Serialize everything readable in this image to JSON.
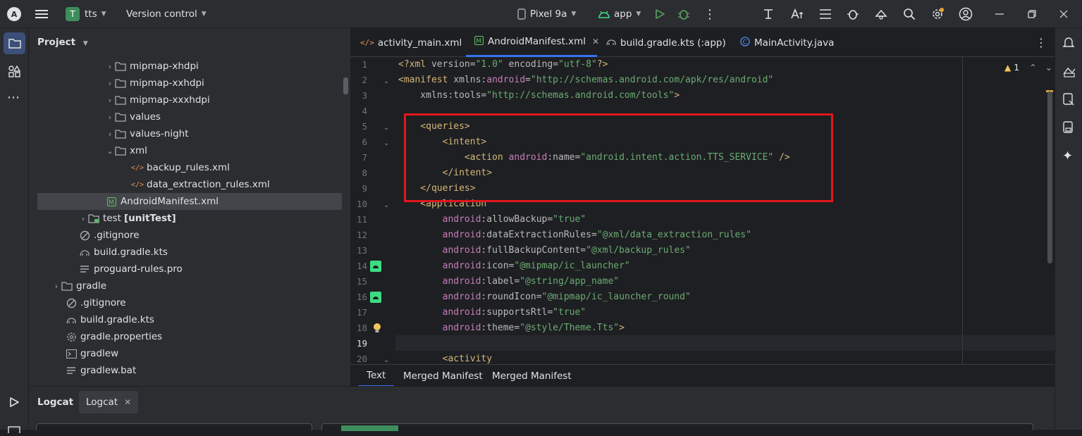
{
  "topbar": {
    "project_letter": "T",
    "project_name": "tts",
    "version_control": "Version control",
    "device": "Pixel 9a",
    "run_config": "app"
  },
  "project_panel": {
    "title": "Project",
    "tree": [
      {
        "label": "mipmap-xhdpi",
        "type": "folder",
        "expander": "›"
      },
      {
        "label": "mipmap-xxhdpi",
        "type": "folder",
        "expander": "›"
      },
      {
        "label": "mipmap-xxxhdpi",
        "type": "folder",
        "expander": "›"
      },
      {
        "label": "values",
        "type": "folder",
        "expander": "›"
      },
      {
        "label": "values-night",
        "type": "folder",
        "expander": "›"
      },
      {
        "label": "xml",
        "type": "folder",
        "expander": "⌄"
      },
      {
        "label": "backup_rules.xml",
        "type": "xml"
      },
      {
        "label": "data_extraction_rules.xml",
        "type": "xml"
      },
      {
        "label": "AndroidManifest.xml",
        "type": "manifest",
        "selected": true
      },
      {
        "label": "test",
        "suffix": "[unitTest]",
        "type": "testfolder",
        "expander": "›"
      },
      {
        "label": ".gitignore",
        "type": "ignore"
      },
      {
        "label": "build.gradle.kts",
        "type": "gradle"
      },
      {
        "label": "proguard-rules.pro",
        "type": "text"
      },
      {
        "label": "gradle",
        "type": "folder",
        "expander": "›"
      },
      {
        "label": ".gitignore",
        "type": "ignore"
      },
      {
        "label": "build.gradle.kts",
        "type": "gradle"
      },
      {
        "label": "gradle.properties",
        "type": "settings"
      },
      {
        "label": "gradlew",
        "type": "terminal"
      },
      {
        "label": "gradlew.bat",
        "type": "text"
      }
    ]
  },
  "editor": {
    "tabs": [
      {
        "label": "activity_main.xml",
        "icon": "xml-icon"
      },
      {
        "label": "AndroidManifest.xml",
        "icon": "manifest-icon",
        "active": true
      },
      {
        "label": "build.gradle.kts (:app)",
        "icon": "gradle-icon"
      },
      {
        "label": "MainActivity.java",
        "icon": "class-icon"
      }
    ],
    "warning_count": "1",
    "lines": [
      {
        "n": "1"
      },
      {
        "n": "2"
      },
      {
        "n": "3"
      },
      {
        "n": "4"
      },
      {
        "n": "5"
      },
      {
        "n": "6"
      },
      {
        "n": "7"
      },
      {
        "n": "8"
      },
      {
        "n": "9"
      },
      {
        "n": "10"
      },
      {
        "n": "11"
      },
      {
        "n": "12"
      },
      {
        "n": "13"
      },
      {
        "n": "14"
      },
      {
        "n": "15"
      },
      {
        "n": "16"
      },
      {
        "n": "17"
      },
      {
        "n": "18"
      },
      {
        "n": "19"
      },
      {
        "n": "20"
      }
    ],
    "bottom_tabs": [
      "Text",
      "Merged Manifest",
      "Merged Manifest"
    ]
  },
  "logcat": {
    "tabs": [
      "Logcat",
      "Logcat"
    ]
  },
  "colors": {
    "highlight_box": "#e2161d",
    "accent": "#3574f0"
  }
}
